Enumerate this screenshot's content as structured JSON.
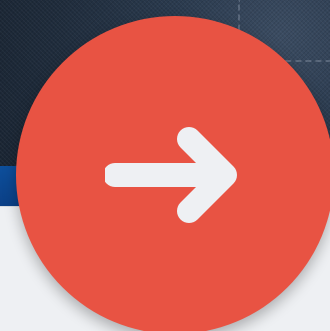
{
  "background": {
    "image": "denim-fabric-photo",
    "stripe_color": "#0d4f9c",
    "panel_color": "#eef0f3"
  },
  "next_button": {
    "icon": "arrow-right-icon",
    "color": "#e85343",
    "icon_color": "#eef0f3"
  }
}
